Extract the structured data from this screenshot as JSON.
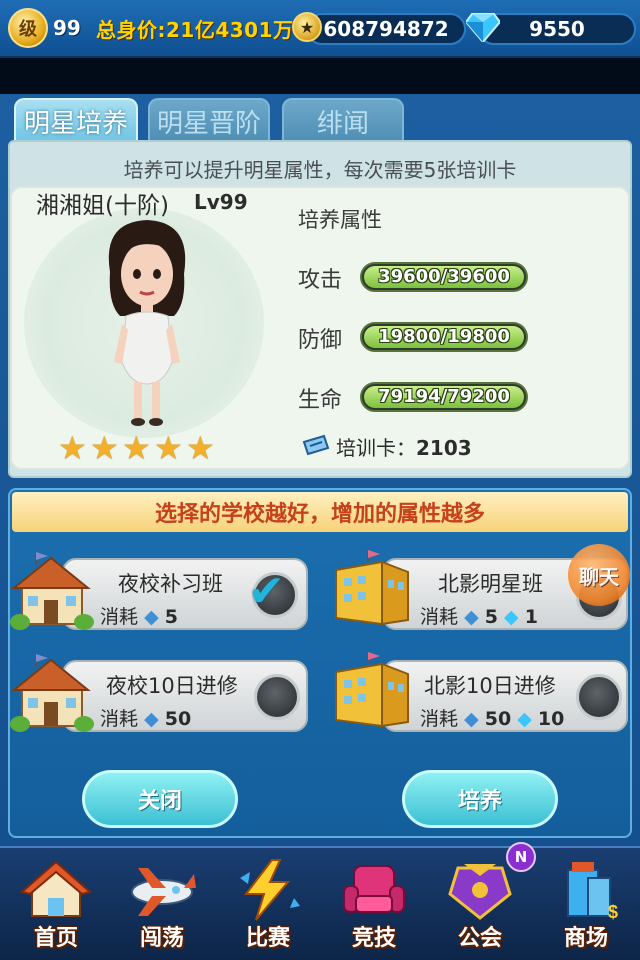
{
  "topbar": {
    "level_badge": "级",
    "level": "99",
    "worth": "总身价:21亿4301万",
    "coins": "608794872",
    "gems": "9550"
  },
  "tabs": [
    {
      "label": "明星培养",
      "active": true
    },
    {
      "label": "明星晋阶",
      "active": false
    },
    {
      "label": "绯闻",
      "active": false
    }
  ],
  "hint": "培养可以提升明星属性，每次需要5张培训卡",
  "star": {
    "name": "湘湘姐(十阶)",
    "level": "Lv99",
    "stars": 5,
    "attr_title": "培养属性",
    "attack": {
      "label": "攻击",
      "value": "39600/39600",
      "fill": 1.0
    },
    "defense": {
      "label": "防御",
      "value": "19800/19800",
      "fill": 1.0
    },
    "life": {
      "label": "生命",
      "value": "79194/79200",
      "fill": 0.99992
    },
    "ticket_label": "培训卡：",
    "ticket_count": "2103"
  },
  "schools": {
    "title": "选择的学校越好，增加的属性越多",
    "cost_label": "消耗",
    "options": [
      {
        "name": "夜校补习班",
        "ticket_cost": "5",
        "gem_cost": "",
        "selected": true
      },
      {
        "name": "北影明星班",
        "ticket_cost": "5",
        "gem_cost": "1",
        "selected": false
      },
      {
        "name": "夜校10日进修",
        "ticket_cost": "50",
        "gem_cost": "",
        "selected": false
      },
      {
        "name": "北影10日进修",
        "ticket_cost": "50",
        "gem_cost": "10",
        "selected": false
      }
    ]
  },
  "chat": "聊天",
  "buttons": {
    "close": "关闭",
    "train": "培养"
  },
  "nav": [
    {
      "label": "首页",
      "icon": "home-icon"
    },
    {
      "label": "闯荡",
      "icon": "airplane-icon"
    },
    {
      "label": "比赛",
      "icon": "lightning-icon"
    },
    {
      "label": "竞技",
      "icon": "armchair-icon"
    },
    {
      "label": "公会",
      "icon": "guild-icon"
    },
    {
      "label": "商场",
      "icon": "shop-icon"
    }
  ],
  "nav_badge": "N",
  "colors": {
    "accent_green": "#7cc13d",
    "school_title": "#c5411c",
    "button_cyan": "#3dc0d3",
    "gem_blue": "#3cc6ff"
  }
}
